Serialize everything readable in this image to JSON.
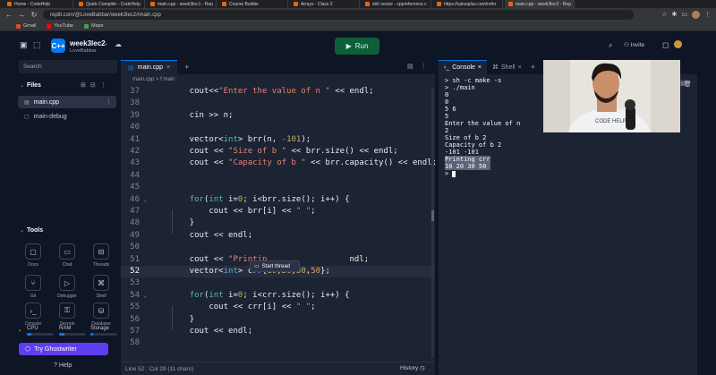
{
  "browser": {
    "tabs": [
      {
        "label": "Home - CodeHelp"
      },
      {
        "label": "Quick Compiler - CodeHelp"
      },
      {
        "label": "main.cpp - week3lec1 - Rep"
      },
      {
        "label": "Course Builder"
      },
      {
        "label": "Arrays - Class 2"
      },
      {
        "label": "std::vector - cppreference.c"
      },
      {
        "label": "https://cplusplus.com/refer"
      },
      {
        "label": "main.cpp - week3lec2 - Rep"
      }
    ],
    "url": "replit.com/@LoveBabbar/week3lec2#main.cpp",
    "bookmarks": [
      {
        "label": "Gmail",
        "color": "#ea4335"
      },
      {
        "label": "YouTube",
        "color": "#ff0000"
      },
      {
        "label": "Maps",
        "color": "#34a853"
      }
    ]
  },
  "header": {
    "logo": "C++",
    "repl_name": "week3lec2",
    "repl_owner": "LoveBabbar",
    "run_label": "Run",
    "invite_label": "Invite"
  },
  "sidebar": {
    "search_placeholder": "Search",
    "files_title": "Files",
    "files": [
      {
        "name": "main.cpp",
        "selected": true
      },
      {
        "name": "main-debug",
        "selected": false
      }
    ],
    "tools_title": "Tools",
    "tools": [
      {
        "label": "Docs",
        "icon": "document-icon"
      },
      {
        "label": "Chat",
        "icon": "chat-icon"
      },
      {
        "label": "Threads",
        "icon": "inbox-icon"
      },
      {
        "label": "Git",
        "icon": "git-icon"
      },
      {
        "label": "Debugger",
        "icon": "debugger-icon"
      },
      {
        "label": "Shell",
        "icon": "shell-icon"
      },
      {
        "label": "Console",
        "icon": "console-icon"
      },
      {
        "label": "Secrets",
        "icon": "lock-icon"
      },
      {
        "label": "Database",
        "icon": "database-icon"
      }
    ],
    "meters": [
      {
        "label": "CPU",
        "level": 0.15
      },
      {
        "label": "RAM",
        "level": 0.2
      },
      {
        "label": "Storage",
        "level": 0.1
      }
    ],
    "ghostwriter_label": "Try Ghostwriter",
    "help_label": "Help"
  },
  "editor": {
    "tab_label": "main.cpp",
    "breadcrumb": "main.cpp > f main",
    "lines": [
      {
        "n": "37",
        "tokens": [
          {
            "t": "    cout<<",
            "c": ""
          },
          {
            "t": "\"Enter the value of n \"",
            "c": "str"
          },
          {
            "t": " << endl;",
            "c": ""
          }
        ]
      },
      {
        "n": "38",
        "tokens": []
      },
      {
        "n": "39",
        "tokens": [
          {
            "t": "    cin >> n;",
            "c": ""
          }
        ]
      },
      {
        "n": "40",
        "tokens": []
      },
      {
        "n": "41",
        "tokens": [
          {
            "t": "    vector<",
            "c": ""
          },
          {
            "t": "int",
            "c": "kw"
          },
          {
            "t": "> brr(n, ",
            "c": ""
          },
          {
            "t": "-101",
            "c": "num"
          },
          {
            "t": ");",
            "c": ""
          }
        ]
      },
      {
        "n": "42",
        "tokens": [
          {
            "t": "    cout << ",
            "c": ""
          },
          {
            "t": "\"Size of b \"",
            "c": "str"
          },
          {
            "t": " << brr.size() << endl;",
            "c": ""
          }
        ]
      },
      {
        "n": "43",
        "tokens": [
          {
            "t": "    cout << ",
            "c": ""
          },
          {
            "t": "\"Capacity of b \"",
            "c": "str"
          },
          {
            "t": " << brr.capacity() << endl;",
            "c": ""
          }
        ]
      },
      {
        "n": "44",
        "tokens": []
      },
      {
        "n": "45",
        "tokens": []
      },
      {
        "n": "46",
        "fold": true,
        "tokens": [
          {
            "t": "    ",
            "c": ""
          },
          {
            "t": "for",
            "c": "kw"
          },
          {
            "t": "(",
            "c": ""
          },
          {
            "t": "int",
            "c": "kw"
          },
          {
            "t": " i=",
            "c": ""
          },
          {
            "t": "0",
            "c": "num"
          },
          {
            "t": "; i<brr.size(); i++) {",
            "c": ""
          }
        ]
      },
      {
        "n": "47",
        "tokens": [
          {
            "t": "        cout << brr[i] << ",
            "c": ""
          },
          {
            "t": "\" \"",
            "c": "str"
          },
          {
            "t": ";",
            "c": ""
          }
        ]
      },
      {
        "n": "48",
        "tokens": [
          {
            "t": "    }",
            "c": ""
          }
        ]
      },
      {
        "n": "49",
        "tokens": [
          {
            "t": "    cout << endl;",
            "c": ""
          }
        ]
      },
      {
        "n": "50",
        "tokens": []
      },
      {
        "n": "51",
        "tokens": [
          {
            "t": "    cout << ",
            "c": ""
          },
          {
            "t": "\"Printin",
            "c": "str"
          },
          {
            "t": "                 ndl;",
            "c": ""
          }
        ]
      },
      {
        "n": "52",
        "active": true,
        "tokens": [
          {
            "t": "    vector<",
            "c": ""
          },
          {
            "t": "int",
            "c": "kw"
          },
          {
            "t": "> crr{",
            "c": ""
          },
          {
            "t": "10",
            "c": "num"
          },
          {
            "t": ",",
            "c": ""
          },
          {
            "t": "20",
            "c": "num"
          },
          {
            "t": ",",
            "c": ""
          },
          {
            "t": "30",
            "c": "num"
          },
          {
            "t": ",",
            "c": ""
          },
          {
            "t": "50",
            "c": "num"
          },
          {
            "t": "};",
            "c": ""
          }
        ]
      },
      {
        "n": "53",
        "tokens": []
      },
      {
        "n": "54",
        "fold": true,
        "tokens": [
          {
            "t": "    ",
            "c": ""
          },
          {
            "t": "for",
            "c": "kw"
          },
          {
            "t": "(",
            "c": ""
          },
          {
            "t": "int",
            "c": "kw"
          },
          {
            "t": " i=",
            "c": ""
          },
          {
            "t": "0",
            "c": "num"
          },
          {
            "t": "; i<crr.size(); i++) {",
            "c": ""
          }
        ]
      },
      {
        "n": "55",
        "tokens": [
          {
            "t": "        cout << crr[i] << ",
            "c": ""
          },
          {
            "t": "\" \"",
            "c": "str"
          },
          {
            "t": ";",
            "c": ""
          }
        ]
      },
      {
        "n": "56",
        "tokens": [
          {
            "t": "    }",
            "c": ""
          }
        ]
      },
      {
        "n": "57",
        "tokens": [
          {
            "t": "    cout << endl;",
            "c": ""
          }
        ]
      },
      {
        "n": "58",
        "tokens": []
      }
    ],
    "thread_popup_label": "Start thread",
    "status": "Line 52 : Col 29 (11 chars)",
    "history_label": "History"
  },
  "console": {
    "tabs": [
      {
        "label": "Console",
        "active": true
      },
      {
        "label": "Shell",
        "active": false
      }
    ],
    "output_before": "> sh -c make -s\n> ./main\n0\n0\n5 6\n5\nEnter the value of n\n2\nSize of b 2\nCapacity of b 2\n-101 -101\n",
    "output_selected": "Printing crr\n10 20 30 50 ",
    "prompt": "> "
  },
  "webcam": {
    "shirt_text": "CODE HELP"
  }
}
